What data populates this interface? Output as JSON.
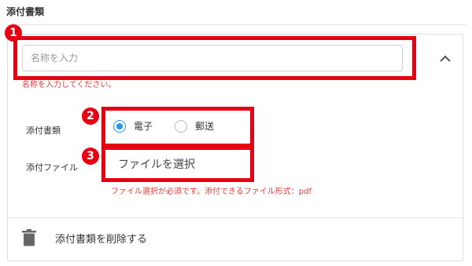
{
  "section": {
    "title": "添付書類"
  },
  "document_card": {
    "name_input": {
      "placeholder": "名称を入力",
      "value": "",
      "error": "名称を入力してください。"
    },
    "collapse_icon": "chevron-up-icon",
    "type_field": {
      "label": "添付書類",
      "options": [
        {
          "label": "電子",
          "selected": true
        },
        {
          "label": "郵送",
          "selected": false
        }
      ]
    },
    "file_field": {
      "label": "添付ファイル",
      "button_label": "ファイルを選択",
      "error": "ファイル選択が必須です。添付できるファイル形式：pdf"
    },
    "delete_action": {
      "label": "添付書類を削除する",
      "icon": "trash-icon"
    }
  },
  "annotations": {
    "badge_1": "1",
    "badge_2": "2",
    "badge_3": "3"
  },
  "colors": {
    "annotation_red": "#e60012",
    "error_red": "#e53935",
    "radio_blue": "#2196f3"
  }
}
